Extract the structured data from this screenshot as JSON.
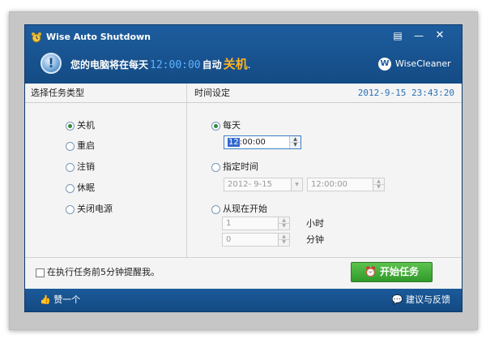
{
  "window": {
    "title": "Wise Auto Shutdown",
    "controls": {
      "menu": "▤",
      "minimize": "—",
      "close": "✕"
    }
  },
  "header": {
    "msg_prefix": "您的电脑将在每天",
    "msg_time": "12:00:00",
    "msg_mid": "自动",
    "msg_action": "关机",
    "msg_suffix": ".",
    "brand": "WiseCleaner",
    "brand_logo": "W"
  },
  "tasks": {
    "heading": "选择任务类型",
    "options": [
      {
        "label": "关机",
        "selected": true
      },
      {
        "label": "重启",
        "selected": false
      },
      {
        "label": "注销",
        "selected": false
      },
      {
        "label": "休眠",
        "selected": false
      },
      {
        "label": "关闭电源",
        "selected": false
      }
    ]
  },
  "timing": {
    "heading": "时间设定",
    "current_datetime": "2012-9-15 23:43:20",
    "daily": {
      "label": "每天",
      "selected": true,
      "time_selected_part": "12",
      "time_rest": ":00:00"
    },
    "specific": {
      "label": "指定时间",
      "selected": false,
      "date": "2012- 9-15",
      "time": "12:00:00"
    },
    "countdown": {
      "label": "从现在开始",
      "selected": false,
      "hours": "1",
      "hours_unit": "小时",
      "minutes": "0",
      "minutes_unit": "分钟"
    }
  },
  "bottom": {
    "remind_label": "在执行任务前5分钟提醒我。",
    "start_label": "开始任务"
  },
  "footer": {
    "like_label": "赞一个",
    "feedback_label": "建议与反馈"
  },
  "colors": {
    "titlebar": "#1d5d9e",
    "time_blue": "#5fb2ff",
    "action_orange": "#ffb320",
    "start_green": "#3ea836",
    "datetime_blue": "#2b72b8"
  }
}
